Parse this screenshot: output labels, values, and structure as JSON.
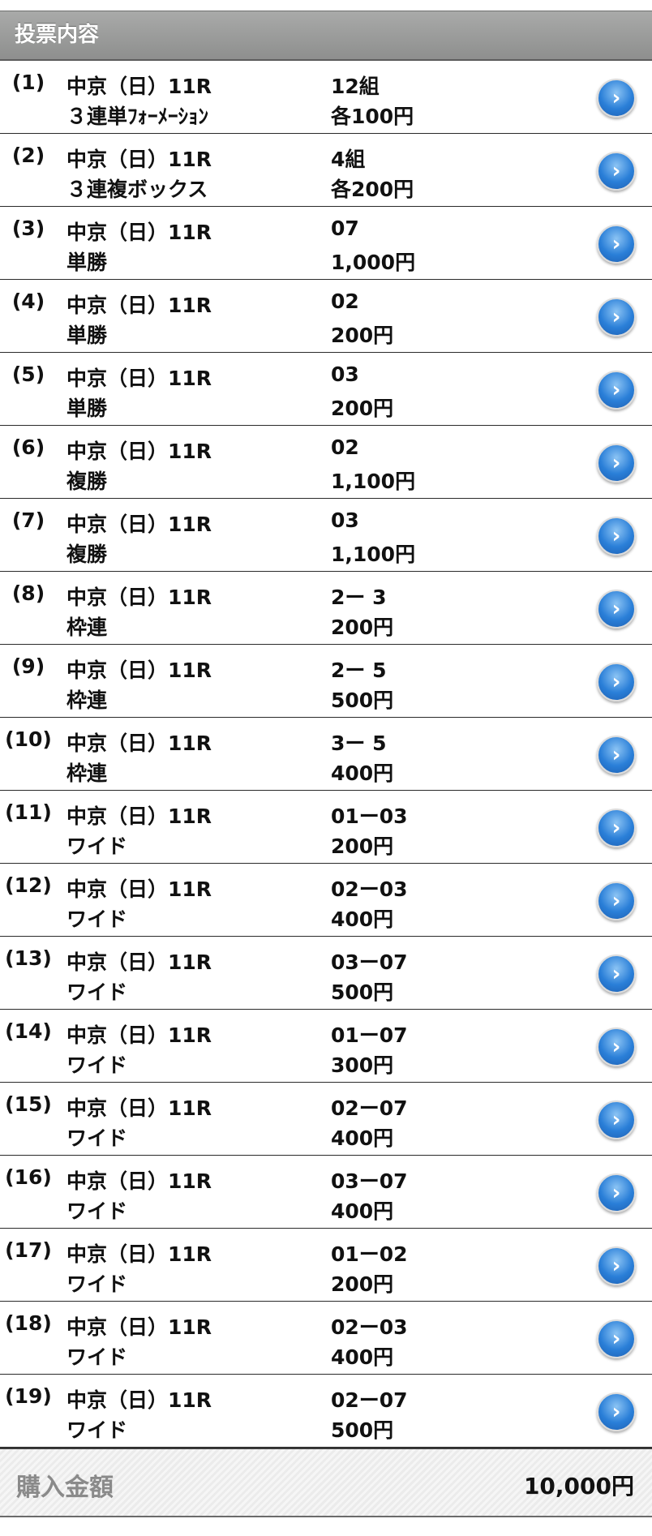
{
  "header": {
    "title": "投票内容"
  },
  "rows": [
    {
      "num": "(1)",
      "race": "中京（日）11R",
      "type": "３連単ﾌｫｰﾒｰｼｮﾝ",
      "combo": "12組",
      "amount": "各100円"
    },
    {
      "num": "(2)",
      "race": "中京（日）11R",
      "type": "３連複ボックス",
      "combo": "4組",
      "amount": "各200円"
    },
    {
      "num": "(3)",
      "race": "中京（日）11R",
      "type": "単勝",
      "combo": "07",
      "amount": "1,000円"
    },
    {
      "num": "(4)",
      "race": "中京（日）11R",
      "type": "単勝",
      "combo": "02",
      "amount": "200円"
    },
    {
      "num": "(5)",
      "race": "中京（日）11R",
      "type": "単勝",
      "combo": "03",
      "amount": "200円"
    },
    {
      "num": "(6)",
      "race": "中京（日）11R",
      "type": "複勝",
      "combo": "02",
      "amount": "1,100円"
    },
    {
      "num": "(7)",
      "race": "中京（日）11R",
      "type": "複勝",
      "combo": "03",
      "amount": "1,100円"
    },
    {
      "num": "(8)",
      "race": "中京（日）11R",
      "type": "枠連",
      "combo": "2ー 3",
      "amount": "200円"
    },
    {
      "num": "(9)",
      "race": "中京（日）11R",
      "type": "枠連",
      "combo": "2ー 5",
      "amount": "500円"
    },
    {
      "num": "(10)",
      "race": "中京（日）11R",
      "type": "枠連",
      "combo": "3ー 5",
      "amount": "400円"
    },
    {
      "num": "(11)",
      "race": "中京（日）11R",
      "type": "ワイド",
      "combo": "01ー03",
      "amount": "200円"
    },
    {
      "num": "(12)",
      "race": "中京（日）11R",
      "type": "ワイド",
      "combo": "02ー03",
      "amount": "400円"
    },
    {
      "num": "(13)",
      "race": "中京（日）11R",
      "type": "ワイド",
      "combo": "03ー07",
      "amount": "500円"
    },
    {
      "num": "(14)",
      "race": "中京（日）11R",
      "type": "ワイド",
      "combo": "01ー07",
      "amount": "300円"
    },
    {
      "num": "(15)",
      "race": "中京（日）11R",
      "type": "ワイド",
      "combo": "02ー07",
      "amount": "400円"
    },
    {
      "num": "(16)",
      "race": "中京（日）11R",
      "type": "ワイド",
      "combo": "03ー07",
      "amount": "400円"
    },
    {
      "num": "(17)",
      "race": "中京（日）11R",
      "type": "ワイド",
      "combo": "01ー02",
      "amount": "200円"
    },
    {
      "num": "(18)",
      "race": "中京（日）11R",
      "type": "ワイド",
      "combo": "02ー03",
      "amount": "400円"
    },
    {
      "num": "(19)",
      "race": "中京（日）11R",
      "type": "ワイド",
      "combo": "02ー07",
      "amount": "500円"
    }
  ],
  "row_action_icon": "chevron-right-circle-icon",
  "total": {
    "label": "購入金額",
    "value": "10,000円"
  },
  "colors": {
    "header_bg": "#9d9e9d",
    "header_text": "#ffffff",
    "chevron_blue": "#2a7fd8",
    "total_label": "#8a8a8a"
  }
}
